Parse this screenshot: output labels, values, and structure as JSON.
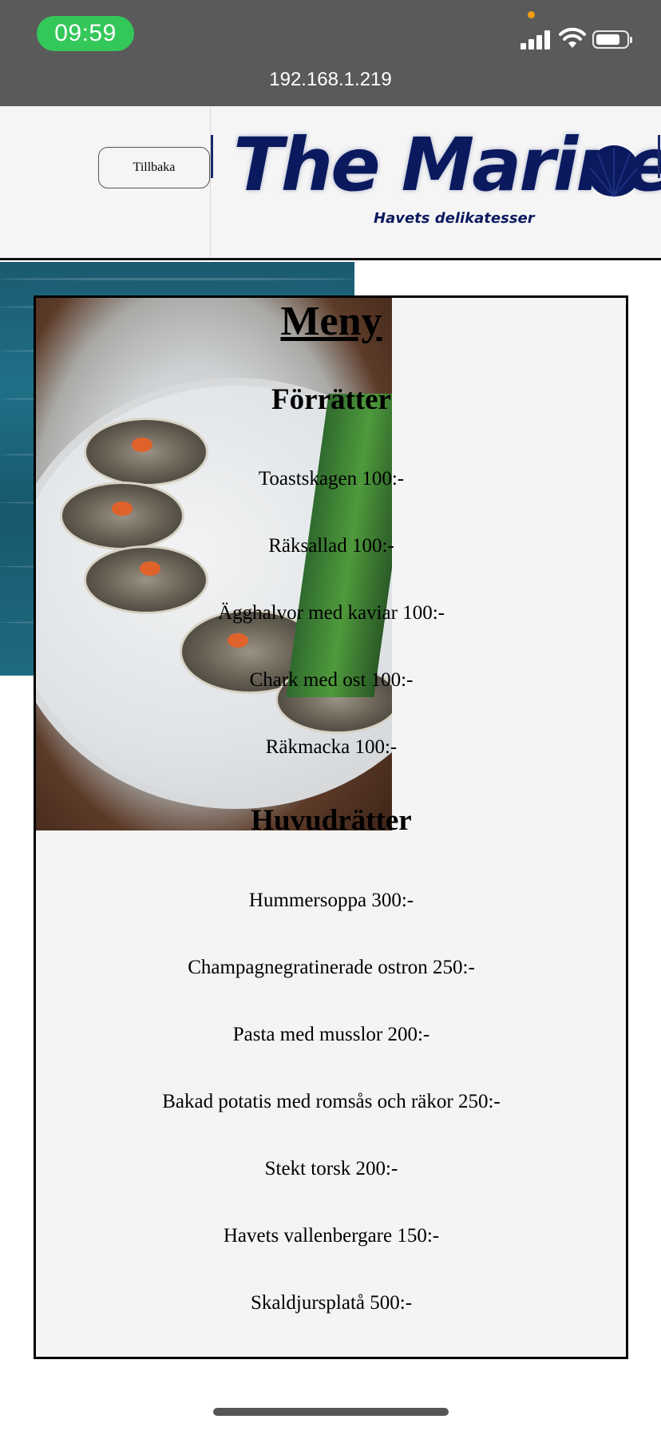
{
  "status_bar": {
    "time": "09:59",
    "url": "192.168.1.219",
    "time_color": "#34c759"
  },
  "header": {
    "back_label": "Tillbaka",
    "logo_title": "The Marine",
    "logo_subtitle": "Havets delikatesser",
    "brand_color": "#0b1a5e"
  },
  "menu": {
    "title": "Meny",
    "sections": [
      {
        "heading": "Förrätter",
        "items": [
          "Toastskagen 100:-",
          "Räksallad 100:-",
          "Ägghalvor med kaviar 100:-",
          "Chark med ost 100:-",
          "Räkmacka 100:-"
        ]
      },
      {
        "heading": "Huvudrätter",
        "items": [
          "Hummersoppa 300:-",
          "Champagnegratinerade ostron 250:-",
          "Pasta med musslor 200:-",
          "Bakad potatis med romsås och räkor 250:-",
          "Stekt torsk 200:-",
          "Havets vallenbergare 150:-",
          "Skaldjursplatå 500:-"
        ]
      }
    ]
  }
}
